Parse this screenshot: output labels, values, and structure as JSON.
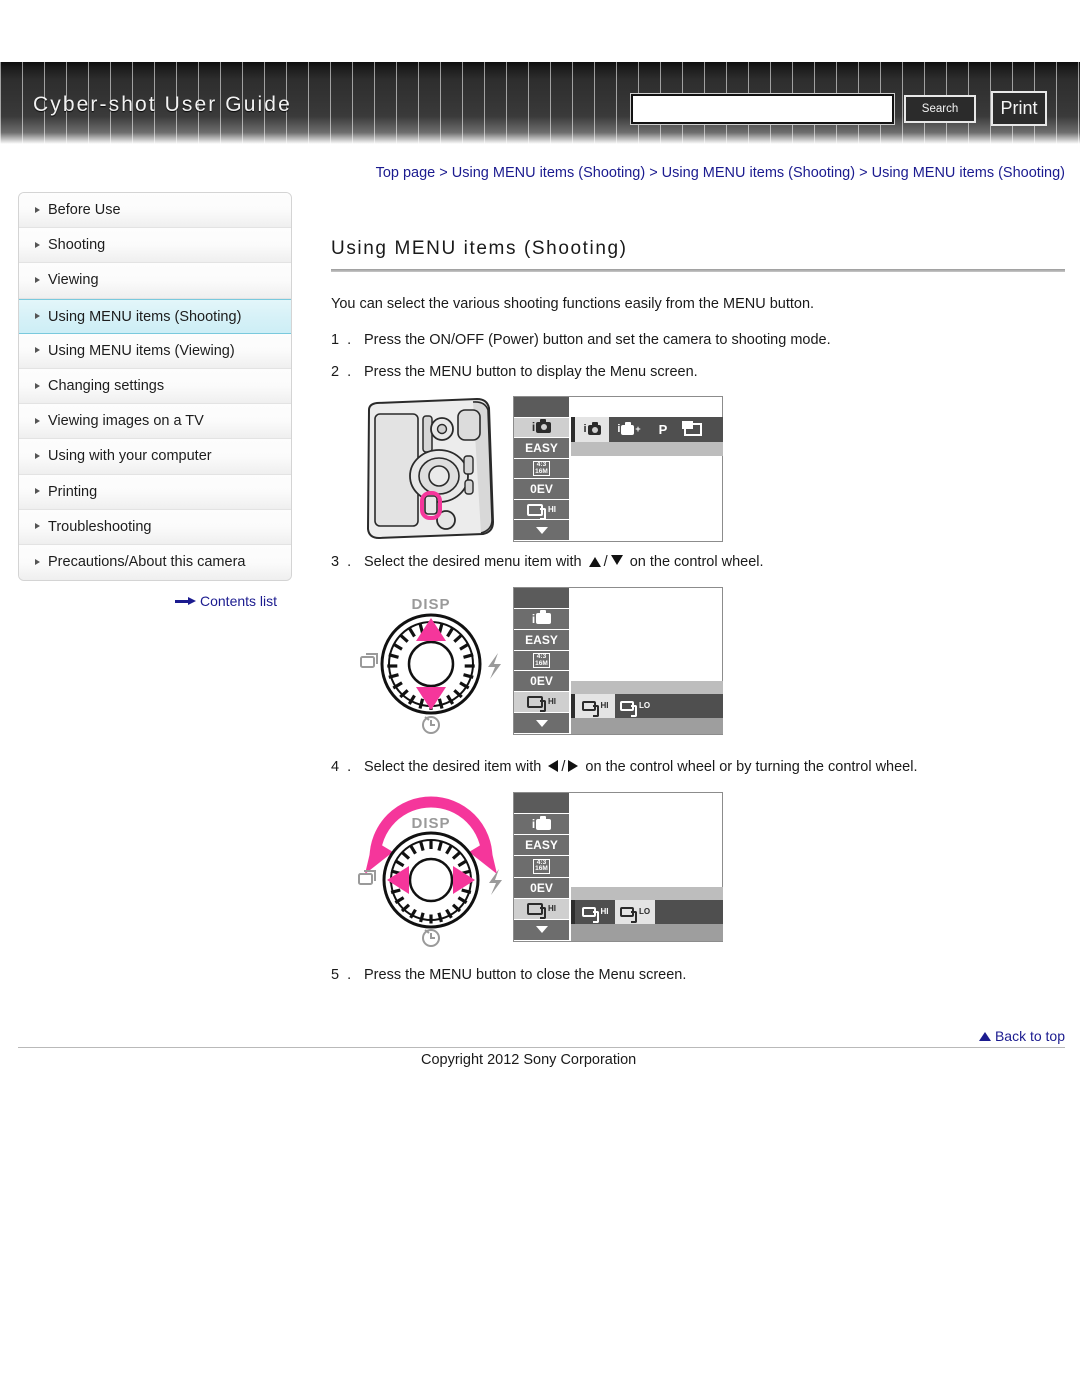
{
  "header": {
    "site_title": "Cyber-shot User Guide",
    "search_placeholder": "",
    "search_value": "",
    "search_button": "Search",
    "print_button": "Print"
  },
  "breadcrumb": {
    "text": "Top page > Using MENU items (Shooting) > Using MENU items (Shooting) > Using MENU items (Shooting)"
  },
  "sidebar": {
    "items": [
      {
        "label": "Before Use",
        "active": false
      },
      {
        "label": "Shooting",
        "active": false
      },
      {
        "label": "Viewing",
        "active": false
      },
      {
        "label": "Using MENU items (Shooting)",
        "active": true
      },
      {
        "label": "Using MENU items (Viewing)",
        "active": false
      },
      {
        "label": "Changing settings",
        "active": false
      },
      {
        "label": "Viewing images on a TV",
        "active": false
      },
      {
        "label": "Using with your computer",
        "active": false
      },
      {
        "label": "Printing",
        "active": false
      },
      {
        "label": "Troubleshooting",
        "active": false
      },
      {
        "label": "Precautions/About this camera",
        "active": false
      }
    ],
    "contents_list": "Contents list"
  },
  "main": {
    "title": "Using MENU items (Shooting)",
    "intro": "You can select the various shooting functions easily from the MENU button.",
    "steps": [
      {
        "num": "1 .",
        "text": "Press the ON/OFF (Power) button and set the camera to shooting mode."
      },
      {
        "num": "2 .",
        "text": "Press the MENU button to display the Menu screen."
      },
      {
        "num": "3 .",
        "text_before": "Select the desired menu item with",
        "text_after": "on the control wheel."
      },
      {
        "num": "4 .",
        "text_before": "Select the desired item with",
        "text_after": "on the control wheel or by turning the control wheel."
      },
      {
        "num": "5 .",
        "text": "Press the MENU button to close the Menu screen."
      }
    ]
  },
  "figures": {
    "camera_menu": {
      "menu_column": [
        "i-camera-icon",
        "EASY",
        "4:3 16M",
        "0EV",
        "burst-hi-icon",
        "down-arrow"
      ],
      "mode_options": [
        "i-camera-icon",
        "i-camera-plus-icon",
        "P",
        "sweep-panorama-icon"
      ],
      "selected_column_index": 0,
      "selected_option_index": 0
    },
    "dial_vertical": {
      "top_label": "DISP",
      "right_label": "flash-icon",
      "left_label": "burst-icon",
      "bottom_label": "self-timer-icon",
      "menu_column": [
        "i-camera-icon",
        "EASY",
        "4:3 16M",
        "0EV",
        "burst-hi-icon",
        "down-arrow"
      ],
      "row_options": [
        "burst-hi-icon",
        "burst-lo-icon"
      ],
      "selected_column_index": 4,
      "selected_option_index": 0
    },
    "dial_horizontal": {
      "top_label": "DISP",
      "right_label": "flash-icon",
      "left_label": "burst-icon",
      "bottom_label": "self-timer-icon",
      "menu_column": [
        "i-camera-icon",
        "EASY",
        "4:3 16M",
        "0EV",
        "burst-hi-icon",
        "down-arrow"
      ],
      "row_options": [
        "burst-hi-icon",
        "burst-lo-icon"
      ],
      "selected_column_index": 4,
      "selected_option_index": 1
    },
    "labels": {
      "easy": "EASY",
      "ev": "0EV",
      "p": "P",
      "hi": "HI",
      "lo": "LO",
      "ratio_top": "4:3",
      "ratio_bottom": "16M",
      "disp": "DISP"
    }
  },
  "footer": {
    "back_to_top": "Back to top",
    "copyright": "Copyright 2012 Sony Corporation"
  },
  "colors": {
    "link": "#1b1b8f",
    "accent_pink": "#f5369b",
    "sidebar_active": "#d6f1f7"
  }
}
